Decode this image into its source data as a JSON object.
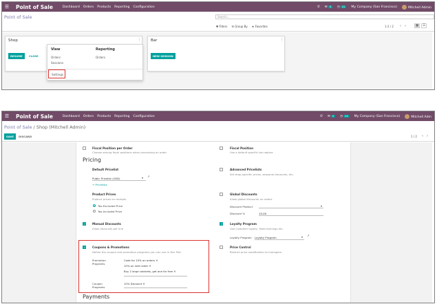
{
  "top": {
    "app_title": "Point of Sale",
    "menu": [
      "Dashboard",
      "Orders",
      "Products",
      "Reporting",
      "Configuration"
    ],
    "msg_count": "5",
    "activity_count": "21",
    "company": "My Company (San Francisco)",
    "user": "Mitchell Admin",
    "breadcrumb": "Point of Sale",
    "search_placeholder": "Search...",
    "filters": "Filters",
    "group_by": "Group By",
    "favorites": "Favorites",
    "pager": "1-2 / 2",
    "cards": [
      {
        "title": "Shop",
        "primary_button": "RESUME",
        "secondary_button": "CLOSE"
      },
      {
        "title": "Bar",
        "primary_button": "NEW SESSION"
      }
    ],
    "dropdown": {
      "view_header": "View",
      "view_items": [
        "Orders",
        "Sessions"
      ],
      "reporting_header": "Reporting",
      "reporting_items": [
        "Orders"
      ],
      "settings": "Settings"
    }
  },
  "bottom": {
    "app_title": "Point of Sale",
    "menu": [
      "Dashboard",
      "Orders",
      "Products",
      "Reporting",
      "Configuration"
    ],
    "msg_count": "5",
    "activity_count": "24",
    "company": "My Company (San Francisco)",
    "user": "Mitchell Adm",
    "breadcrumb_root": "Point of Sale",
    "breadcrumb_sep": "/",
    "breadcrumb_current": "Shop (Mitchell Admin)",
    "save": "SAVE",
    "discard": "DISCARD",
    "pager": "1 / 2",
    "fiscal_per_order": {
      "label": "Fiscal Position per Order",
      "desc": "Choose among fiscal positions when processing an order"
    },
    "fiscal_position": {
      "label": "Fiscal Position",
      "desc": "Use a default specific tax regime"
    },
    "pricing_title": "Pricing",
    "default_pricelist": {
      "label": "Default Pricelist",
      "value": "Public Pricelist (USD)",
      "link": "Pricelists"
    },
    "advanced_pricelists": {
      "label": "Advanced Pricelists",
      "desc": "Set shop-specific prices, seasonal discounts, etc."
    },
    "product_prices": {
      "label": "Product Prices",
      "desc": "Product prices on receipts",
      "options": [
        "Tax-Excluded Price",
        "Tax-Included Price"
      ]
    },
    "global_discounts": {
      "label": "Global Discounts",
      "desc": "Allow global discounts on orders",
      "product_label": "Discount Product",
      "pct_label": "Discount %",
      "pct_value": "10.00"
    },
    "manual_discounts": {
      "label": "Manual Discounts",
      "desc": "Allow discounts per line"
    },
    "loyalty": {
      "label": "Loyalty Program",
      "desc": "Use customer loyalty, fixed earnings etc.",
      "field_label": "Loyalty Program",
      "field_value": "Loyalty Program"
    },
    "coupons": {
      "label": "Coupons & Promotions",
      "desc": "Define the coupon and promotion programs you can use in this PoS.",
      "promo_label": "Promotion Programs",
      "promo_items": [
        "Code for 10% on orders",
        "10% on next order",
        "Buy 2 large cabinets, get one for free"
      ],
      "coupon_label": "Coupon Programs",
      "coupon_items": [
        "10% Discount"
      ]
    },
    "price_control": {
      "label": "Price Control",
      "desc": "Restrict price modification to managers"
    },
    "payments_title": "Payments"
  }
}
